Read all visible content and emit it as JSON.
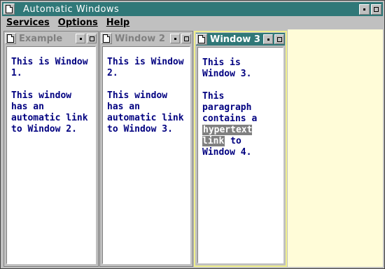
{
  "app": {
    "title": "Automatic Windows"
  },
  "menu": [
    "Services",
    "Options",
    "Help"
  ],
  "windows": [
    {
      "title": "Example",
      "para1": "This is Window 1.",
      "para2": "This window has an automatic link to Window 2."
    },
    {
      "title": "Window 2",
      "para1": "This is Window 2.",
      "para2": "This window has an automatic link to Window 3."
    },
    {
      "title": "Window 3",
      "para1": "This is Window 3.",
      "para2_before": "This paragraph contains a",
      "link": "hypertext link",
      "para2_after": "to Window 4."
    }
  ],
  "colors": {
    "title_active": "#307878",
    "content_text": "#000080",
    "active_border": "#f0f08c",
    "workspace_empty": "#fffcd8"
  }
}
